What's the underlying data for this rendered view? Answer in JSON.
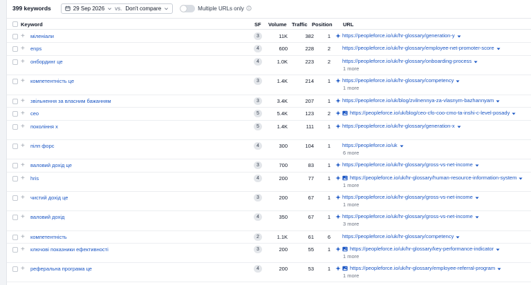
{
  "header": {
    "keyword_count": "399 keywords",
    "date": "29 Sep 2026",
    "vs_label": "vs.",
    "compare": "Don't compare",
    "multiple_urls_label": "Multiple URLs only"
  },
  "columns": {
    "keyword": "Keyword",
    "sf": "SF",
    "volume": "Volume",
    "traffic": "Traffic",
    "position": "Position",
    "url": "URL"
  },
  "rows": [
    {
      "keyword": "міленіали",
      "sf": "3",
      "volume": "11K",
      "traffic": "382",
      "position": "1",
      "url": "https://peopleforce.io/uk/hr-glossary/generation-y",
      "spark": true,
      "image": false,
      "more": ""
    },
    {
      "keyword": "enps",
      "sf": "4",
      "volume": "600",
      "traffic": "228",
      "position": "2",
      "url": "https://peopleforce.io/uk/hr-glossary/employee-net-promoter-score",
      "spark": false,
      "image": false,
      "more": ""
    },
    {
      "keyword": "онбординг це",
      "sf": "4",
      "volume": "1.0K",
      "traffic": "223",
      "position": "2",
      "url": "https://peopleforce.io/uk/hr-glossary/onboarding-process",
      "spark": false,
      "image": false,
      "more": "1 more"
    },
    {
      "keyword": "компетентність це",
      "sf": "3",
      "volume": "1.4K",
      "traffic": "214",
      "position": "1",
      "url": "https://peopleforce.io/uk/hr-glossary/competency",
      "spark": true,
      "image": false,
      "more": "1 more"
    },
    {
      "keyword": "звільнення за власним бажанням",
      "sf": "3",
      "volume": "3.4K",
      "traffic": "207",
      "position": "1",
      "url": "https://peopleforce.io/uk/blog/zvilnennya-za-vlasnym-bazhannyam",
      "spark": true,
      "image": false,
      "more": ""
    },
    {
      "keyword": "ceo",
      "sf": "5",
      "volume": "5.4K",
      "traffic": "123",
      "position": "2",
      "url": "https://peopleforce.io/uk/blog/ceo-cfo-coo-cmo-ta-inshi-c-level-posady",
      "spark": true,
      "image": true,
      "more": ""
    },
    {
      "keyword": "покоління х",
      "sf": "5",
      "volume": "1.4K",
      "traffic": "111",
      "position": "1",
      "url": "https://peopleforce.io/uk/hr-glossary/generation-x",
      "spark": true,
      "image": false,
      "more": ""
    },
    {
      "keyword": "пілп форс",
      "sf": "4",
      "volume": "300",
      "traffic": "104",
      "position": "1",
      "url": "https://peopleforce.io/uk",
      "spark": false,
      "image": false,
      "more": "6 more"
    },
    {
      "keyword": "валовий дохід це",
      "sf": "3",
      "volume": "700",
      "traffic": "83",
      "position": "1",
      "url": "https://peopleforce.io/uk/hr-glossary/gross-vs-net-income",
      "spark": true,
      "image": false,
      "more": ""
    },
    {
      "keyword": "hris",
      "sf": "4",
      "volume": "200",
      "traffic": "77",
      "position": "1",
      "url": "https://peopleforce.io/uk/hr-glossary/human-resource-information-system",
      "spark": true,
      "image": true,
      "more": "1 more"
    },
    {
      "keyword": "чистий дохід це",
      "sf": "3",
      "volume": "200",
      "traffic": "67",
      "position": "1",
      "url": "https://peopleforce.io/uk/hr-glossary/gross-vs-net-income",
      "spark": true,
      "image": false,
      "more": "1 more"
    },
    {
      "keyword": "валовий дохід",
      "sf": "4",
      "volume": "350",
      "traffic": "67",
      "position": "1",
      "url": "https://peopleforce.io/uk/hr-glossary/gross-vs-net-income",
      "spark": true,
      "image": false,
      "more": "3 more"
    },
    {
      "keyword": "компетентність",
      "sf": "2",
      "volume": "1.1K",
      "traffic": "61",
      "position": "6",
      "url": "https://peopleforce.io/uk/hr-glossary/competency",
      "spark": false,
      "image": false,
      "more": ""
    },
    {
      "keyword": "ключові показники ефективності",
      "sf": "3",
      "volume": "200",
      "traffic": "55",
      "position": "1",
      "url": "https://peopleforce.io/uk/hr-glossary/key-performance-indicator",
      "spark": true,
      "image": true,
      "more": "1 more"
    },
    {
      "keyword": "реферальна програма це",
      "sf": "4",
      "volume": "200",
      "traffic": "53",
      "position": "1",
      "url": "https://peopleforce.io/uk/hr-glossary/employee-referral-program",
      "spark": true,
      "image": true,
      "more": "1 more"
    }
  ],
  "colors": {
    "link": "#1a56c4",
    "spark": "#1a56c4",
    "badge": "#e3e6ea"
  },
  "icons": {
    "calendar": "calendar-icon",
    "info": "info-icon",
    "spark": "sparkle-icon",
    "image": "image-icon"
  }
}
